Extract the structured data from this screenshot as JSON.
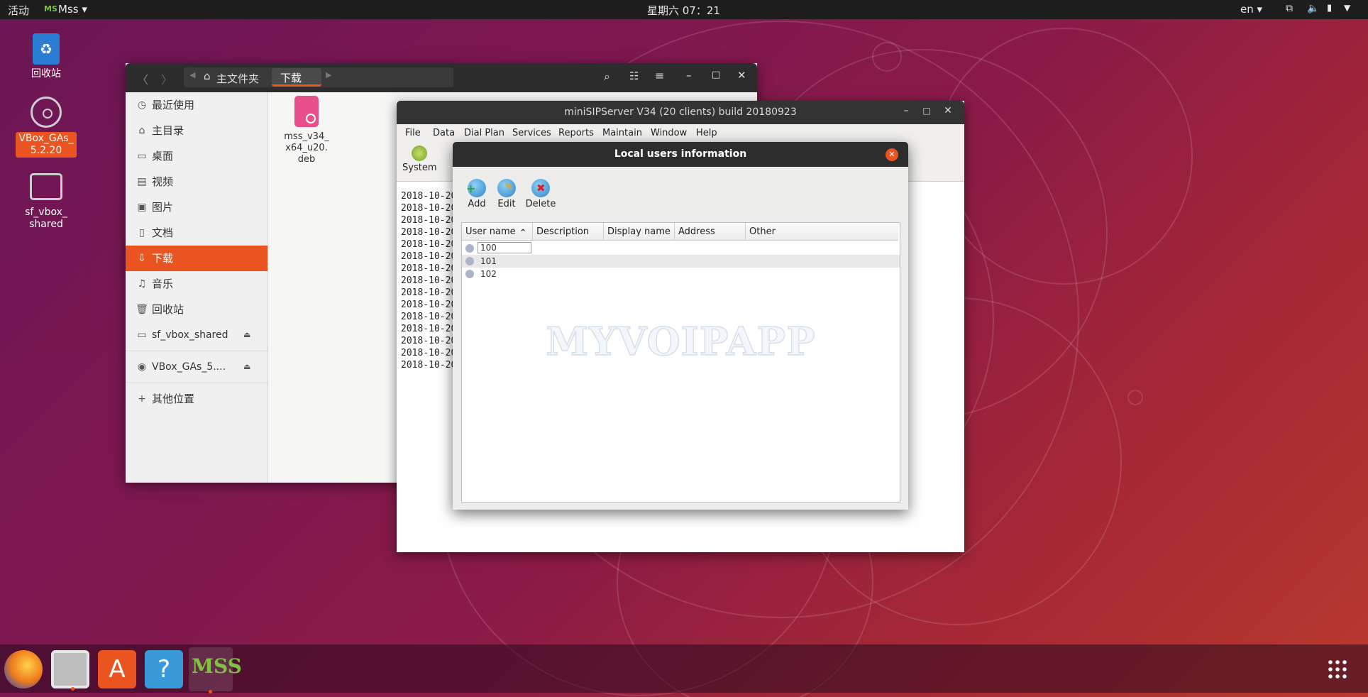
{
  "topbar": {
    "activities": "活动",
    "app_name": "Mss",
    "clock": "星期六 07：21",
    "lang": "en"
  },
  "desktop": {
    "icons": [
      {
        "label": "回收站",
        "icon": "trash-icon"
      },
      {
        "label": "VBox_GAs_\n5.2.20",
        "icon": "disc-icon"
      },
      {
        "label": "sf_vbox_\nshared",
        "icon": "drive-icon"
      }
    ]
  },
  "file_manager": {
    "breadcrumb_home": "主文件夹",
    "breadcrumb_current": "下载",
    "sidebar": [
      {
        "icon": "clock-icon",
        "label": "最近使用"
      },
      {
        "icon": "home-icon",
        "label": "主目录"
      },
      {
        "icon": "desktop-icon",
        "label": "桌面"
      },
      {
        "icon": "video-icon",
        "label": "视频"
      },
      {
        "icon": "image-icon",
        "label": "图片"
      },
      {
        "icon": "document-icon",
        "label": "文档"
      },
      {
        "icon": "download-icon",
        "label": "下载",
        "active": true
      },
      {
        "icon": "music-icon",
        "label": "音乐"
      },
      {
        "icon": "trash-icon",
        "label": "回收站"
      }
    ],
    "devices": [
      {
        "icon": "drive-icon",
        "label": "sf_vbox_shared"
      },
      {
        "icon": "disc-icon",
        "label": "VBox_GAs_5...."
      }
    ],
    "other_locations": "其他位置",
    "files": [
      {
        "name": "mss_v34_\nx64_u20.\ndeb"
      }
    ]
  },
  "minisip": {
    "title": "miniSIPServer V34 (20 clients) build 20180923",
    "menu": [
      "File",
      "Data",
      "Dial Plan",
      "Services",
      "Reports",
      "Maintain",
      "Window",
      "Help"
    ],
    "toolbar_system": "System",
    "log_lines": [
      "2018-10-20",
      "2018-10-20",
      "2018-10-20",
      "2018-10-20",
      "2018-10-20",
      "2018-10-20",
      "2018-10-20",
      "2018-10-20",
      "2018-10-20",
      "2018-10-20",
      "2018-10-20",
      "2018-10-20",
      "2018-10-20",
      "2018-10-20",
      "2018-10-20"
    ]
  },
  "dialog": {
    "title": "Local users information",
    "toolbar": {
      "add": "Add",
      "edit": "Edit",
      "delete": "Delete"
    },
    "columns": [
      "User name",
      "Description",
      "Display name",
      "Address",
      "Other"
    ],
    "sort_indicator": "^",
    "users": [
      {
        "name": "100"
      },
      {
        "name": "101"
      },
      {
        "name": "102"
      }
    ],
    "watermark": "MYVOIPAPP"
  },
  "dock": {
    "apps": [
      "firefox-icon",
      "files-icon",
      "software-icon",
      "help-icon",
      "mss-icon"
    ],
    "mss_label": "MSS"
  }
}
